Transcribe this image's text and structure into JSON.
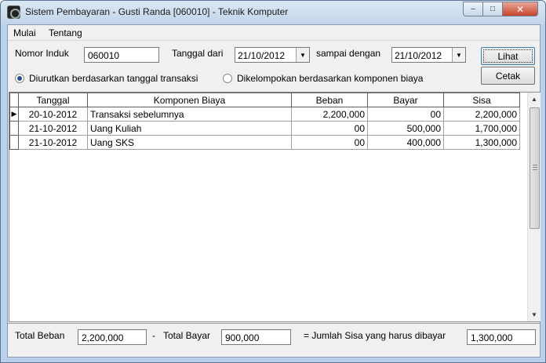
{
  "window": {
    "title": "Sistem Pembayaran - Gusti Randa [060010] - Teknik Komputer",
    "controls": {
      "minimize": "–",
      "maximize": "□",
      "close": "✕"
    }
  },
  "menu": {
    "items": [
      "Mulai",
      "Tentang"
    ]
  },
  "form": {
    "nomor_induk_label": "Nomor Induk",
    "nomor_induk_value": "060010",
    "tanggal_dari_label": "Tanggal dari",
    "tanggal_dari_value": "21/10/2012",
    "sampai_dengan_label": "sampai dengan",
    "sampai_dengan_value": "21/10/2012",
    "lihat_button": "Lihat",
    "cetak_button": "Cetak",
    "radio_tanggal_label": "Diurutkan berdasarkan tanggal transaksi",
    "radio_komponen_label": "Dikelompokan berdasarkan komponen biaya",
    "selected_radio": "tanggal"
  },
  "table": {
    "columns": [
      "Tanggal",
      "Komponen Biaya",
      "Beban",
      "Bayar",
      "Sisa"
    ],
    "rows": [
      {
        "tanggal": "20-10-2012",
        "komponen": "Transaksi sebelumnya",
        "beban": "2,200,000",
        "bayar": "00",
        "sisa": "2,200,000"
      },
      {
        "tanggal": "21-10-2012",
        "komponen": "Uang Kuliah",
        "beban": "00",
        "bayar": "500,000",
        "sisa": "1,700,000"
      },
      {
        "tanggal": "21-10-2012",
        "komponen": "Uang SKS",
        "beban": "00",
        "bayar": "400,000",
        "sisa": "1,300,000"
      }
    ]
  },
  "totals": {
    "total_beban_label": "Total Beban",
    "total_beban_value": "2,200,000",
    "minus_sign": "-",
    "total_bayar_label": "Total Bayar",
    "total_bayar_value": "900,000",
    "jumlah_sisa_label": "= Jumlah Sisa yang harus dibayar",
    "jumlah_sisa_value": "1,300,000"
  },
  "colors": {
    "window_frame": "#b9d1ea",
    "client_background": "#f0f0f0",
    "close_button": "#c7432b"
  },
  "icons": {
    "app": "app-icon",
    "combo_arrow": "▼",
    "row_pointer": "▶",
    "scroll_up": "▲",
    "scroll_down": "▼"
  }
}
